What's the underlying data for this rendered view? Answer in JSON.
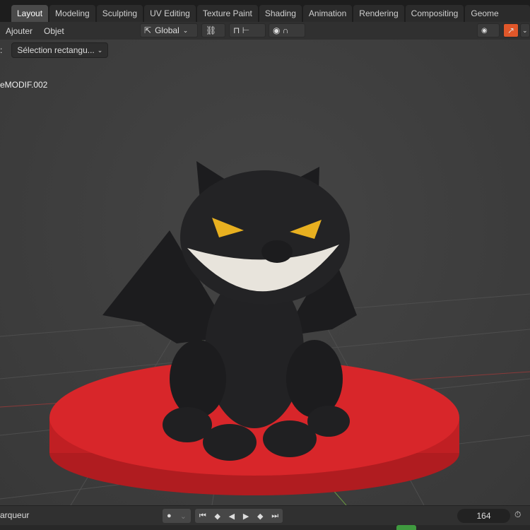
{
  "tabs": [
    "Layout",
    "Modeling",
    "Sculpting",
    "UV Editing",
    "Texture Paint",
    "Shading",
    "Animation",
    "Rendering",
    "Compositing",
    "Geome"
  ],
  "header": {
    "menus": [
      "Ajouter",
      "Objet"
    ],
    "orientation": "Global"
  },
  "tool": {
    "prefix": ":",
    "selection_mode": "Sélection rectangu..."
  },
  "viewport": {
    "object_name": "eMODIF.002"
  },
  "timeline": {
    "label": "arqueur",
    "current_frame": "164"
  },
  "colors": {
    "accent": "#e0572a",
    "disc": "#d8262a",
    "cat": "#1c1c1e",
    "eyes": "#e8b020"
  }
}
